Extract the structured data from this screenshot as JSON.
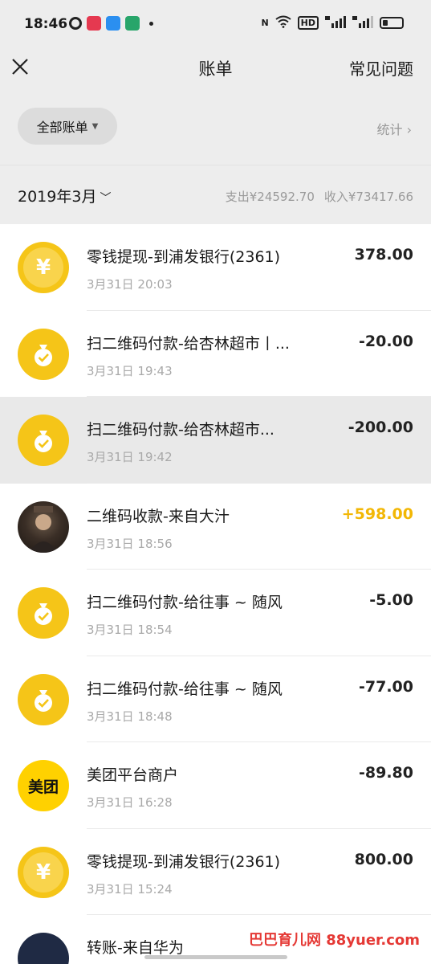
{
  "status": {
    "time": "18:46"
  },
  "nav": {
    "title": "账单",
    "right": "常见问题"
  },
  "filter": {
    "label": "全部账单",
    "stats": "统计 ›"
  },
  "month": {
    "label": "2019年3月",
    "expense": "支出¥24592.70",
    "income": "收入¥73417.66"
  },
  "rows": [
    {
      "title": "零钱提现-到浦发银行(2361)",
      "time": "3月31日 20:03",
      "amount": "378.00",
      "icon": "yuan"
    },
    {
      "title": "扫二维码付款-给杏林超市丨...",
      "time": "3月31日 19:43",
      "amount": "-20.00",
      "icon": "money-bag"
    },
    {
      "title": "扫二维码付款-给杏林超市...",
      "time": "3月31日 19:42",
      "amount": "-200.00",
      "icon": "money-bag"
    },
    {
      "title": "二维码收款-来自大汁",
      "time": "3月31日 18:56",
      "amount": "+598.00",
      "icon": "user-photo"
    },
    {
      "title": "扫二维码付款-给往事 ~ 随风",
      "time": "3月31日 18:54",
      "amount": "-5.00",
      "icon": "money-bag"
    },
    {
      "title": "扫二维码付款-给往事 ~ 随风",
      "time": "3月31日 18:48",
      "amount": "-77.00",
      "icon": "money-bag"
    },
    {
      "title": "美团平台商户",
      "time": "3月31日 16:28",
      "amount": "-89.80",
      "icon": "meituan",
      "logo_text": "美团"
    },
    {
      "title": "零钱提现-到浦发银行(2361)",
      "time": "3月31日 15:24",
      "amount": "800.00",
      "icon": "yuan"
    },
    {
      "title": "转账-来自华为",
      "time": "",
      "amount": "",
      "icon": "user-photo"
    }
  ],
  "watermark": "巴巴育儿网 88yuer.com"
}
